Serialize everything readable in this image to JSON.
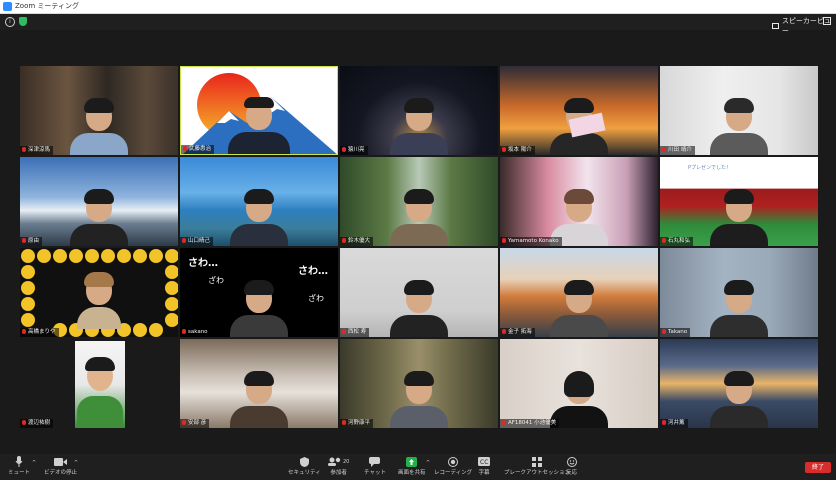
{
  "window": {
    "title": "Zoom ミーティング"
  },
  "topbar": {
    "speaker_view_label": "スピーカービュー"
  },
  "participants": [
    {
      "name": "深津涼馬"
    },
    {
      "name": "武藤惠治"
    },
    {
      "name": "猿川亮"
    },
    {
      "name": "坂本 陽介"
    },
    {
      "name": "川田 靖介"
    },
    {
      "name": "原由"
    },
    {
      "name": "山口晴己"
    },
    {
      "name": "鈴木優大"
    },
    {
      "name": "Yamamoto Konako"
    },
    {
      "name": "石丸和弘"
    },
    {
      "name": "高橋まりや"
    },
    {
      "name": "sakano"
    },
    {
      "name": "西松 寿"
    },
    {
      "name": "金子 拓海"
    },
    {
      "name": "Takano"
    },
    {
      "name": "渡辺祐樹"
    },
    {
      "name": "安部 彦"
    },
    {
      "name": "河野康平"
    },
    {
      "name": "AF18041 小池優美"
    },
    {
      "name": "河井薫"
    }
  ],
  "overlay_text": {
    "sawa_large": "さわ…",
    "sawa_small": "ざわ",
    "banner_small": "Pプレゼンでした！"
  },
  "toolbar": {
    "mute_label": "ミュート",
    "video_label": "ビデオの停止",
    "security_label": "セキュリティ",
    "participants_label": "参加者",
    "participants_count": "20",
    "chat_label": "チャット",
    "share_label": "画面を共有",
    "record_label": "レコーディング",
    "caption_label": "字幕",
    "breakout_label": "ブレークアウトセッション",
    "reactions_label": "反応",
    "end_label": "終了"
  },
  "colors": {
    "zoom_blue": "#2d8cff",
    "share_green": "#22b24c",
    "end_red": "#d92d2d",
    "mute_red": "#e02828"
  }
}
